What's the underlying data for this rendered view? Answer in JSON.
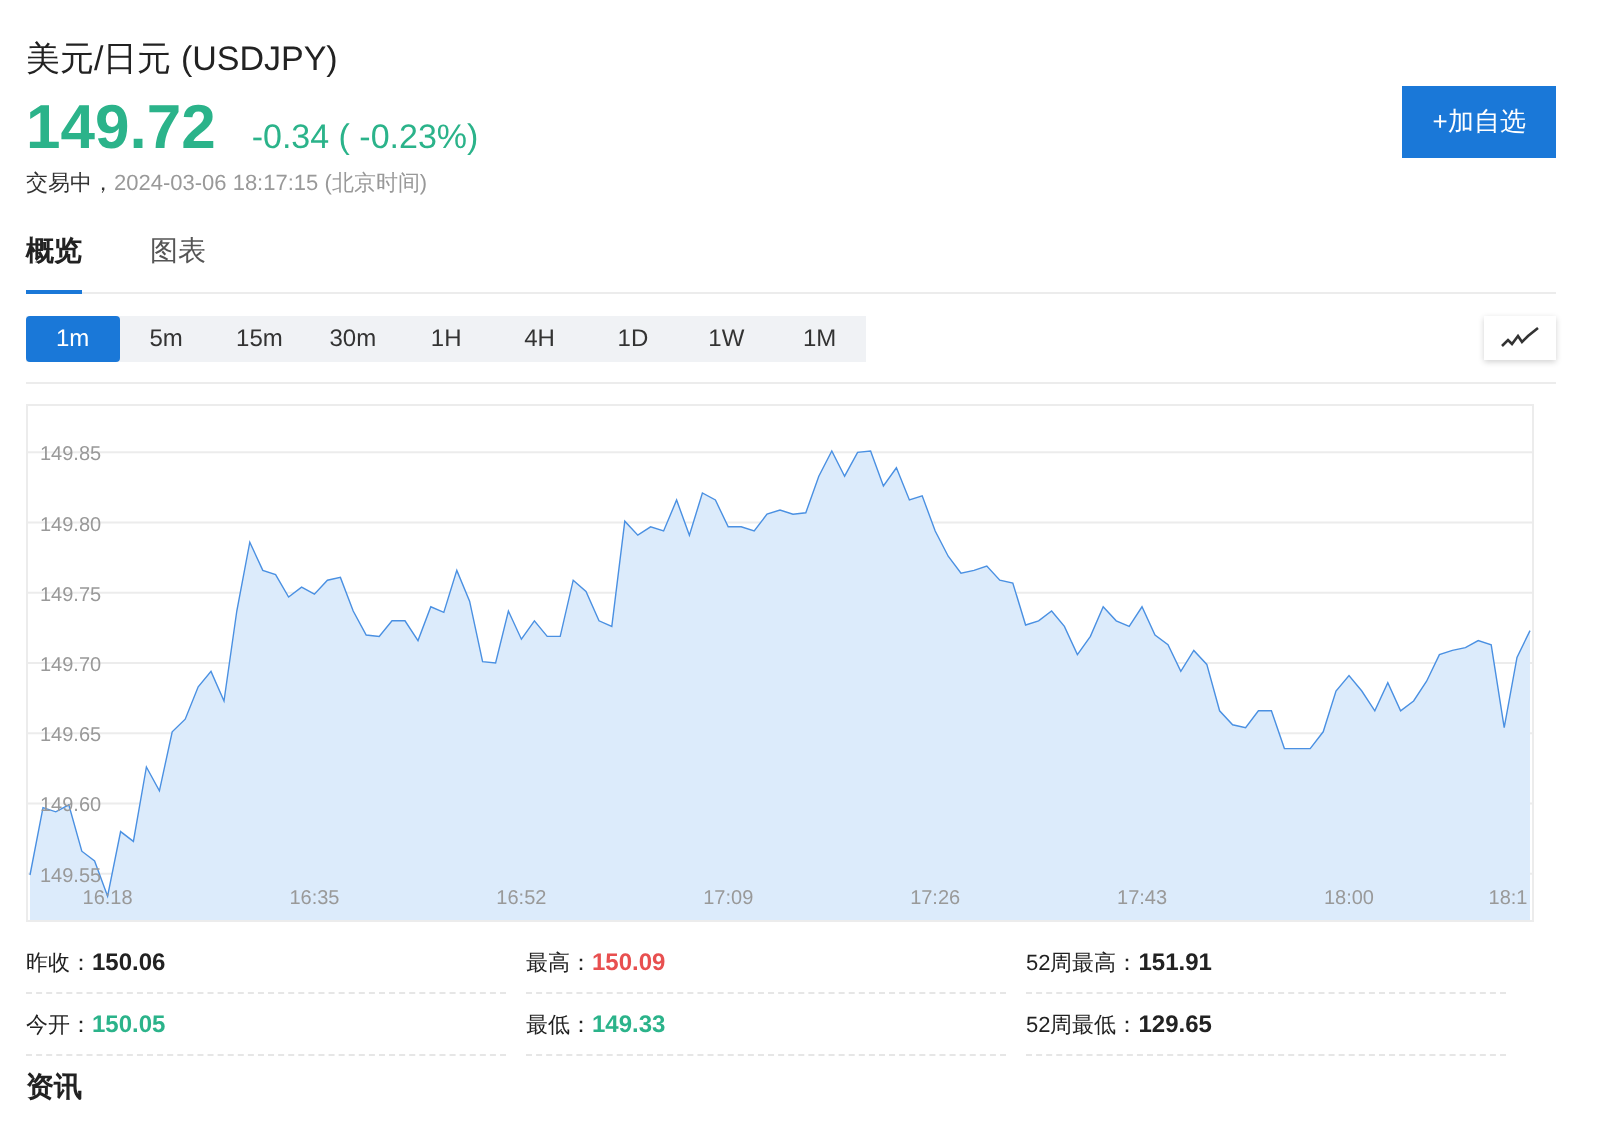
{
  "title": "美元/日元 (USDJPY)",
  "quote": {
    "price": "149.72",
    "change": "-0.34 ( -0.23%)",
    "status": "交易中，",
    "time": "2024-03-06 18:17:15 (北京时间)"
  },
  "watch_button": "+加自选",
  "tabs": [
    {
      "label": "概览",
      "selected": true
    },
    {
      "label": "图表",
      "selected": false
    }
  ],
  "periods": [
    {
      "label": "1m",
      "selected": true
    },
    {
      "label": "5m",
      "selected": false
    },
    {
      "label": "15m",
      "selected": false
    },
    {
      "label": "30m",
      "selected": false
    },
    {
      "label": "1H",
      "selected": false
    },
    {
      "label": "4H",
      "selected": false
    },
    {
      "label": "1D",
      "selected": false
    },
    {
      "label": "1W",
      "selected": false
    },
    {
      "label": "1M",
      "selected": false
    }
  ],
  "time_axis": [
    "16:18",
    "16:35",
    "16:52",
    "17:09",
    "17:26",
    "17:43",
    "18:00",
    "18:1"
  ],
  "chart_data": {
    "type": "area",
    "grid": true,
    "ylim": [
      149.517,
      149.883
    ],
    "yticks": [
      {
        "value": 149.55,
        "label": "149.55"
      },
      {
        "value": 149.6,
        "label": "149.60"
      },
      {
        "value": 149.65,
        "label": "149.65"
      },
      {
        "value": 149.7,
        "label": "149.70"
      },
      {
        "value": 149.75,
        "label": "149.75"
      },
      {
        "value": 149.8,
        "label": "149.80"
      },
      {
        "value": 149.85,
        "label": "149.85"
      }
    ],
    "series": [
      {
        "color": "#4a90e2",
        "values": [
          149.549,
          149.597,
          149.594,
          149.599,
          149.566,
          149.559,
          149.534,
          149.58,
          149.573,
          149.626,
          149.609,
          149.651,
          149.66,
          149.683,
          149.694,
          149.673,
          149.737,
          149.786,
          149.766,
          149.763,
          149.747,
          149.754,
          149.749,
          149.759,
          149.761,
          149.737,
          149.72,
          149.719,
          149.73,
          149.73,
          149.716,
          149.74,
          149.736,
          149.766,
          149.744,
          149.701,
          149.7,
          149.737,
          149.717,
          149.73,
          149.719,
          149.719,
          149.759,
          149.751,
          149.73,
          149.726,
          149.801,
          149.791,
          149.797,
          149.794,
          149.816,
          149.791,
          149.821,
          149.816,
          149.797,
          149.797,
          149.794,
          149.806,
          149.809,
          149.806,
          149.807,
          149.833,
          149.851,
          149.833,
          149.85,
          149.851,
          149.826,
          149.839,
          149.816,
          149.819,
          149.794,
          149.776,
          149.764,
          149.766,
          149.769,
          149.759,
          149.757,
          149.727,
          149.73,
          149.737,
          149.726,
          149.706,
          149.719,
          149.74,
          149.73,
          149.726,
          149.74,
          149.72,
          149.713,
          149.694,
          149.709,
          149.699,
          149.666,
          149.656,
          149.654,
          149.666,
          149.666,
          149.639,
          149.639,
          149.639,
          149.651,
          149.68,
          149.691,
          149.68,
          149.666,
          149.686,
          149.666,
          149.673,
          149.687,
          149.706,
          149.709,
          149.711,
          149.716,
          149.713,
          149.654,
          149.704,
          149.723
        ]
      }
    ]
  },
  "stats": [
    {
      "label": "昨收：",
      "value": "150.06",
      "color": "#222222"
    },
    {
      "label": "最高：",
      "value": "150.09",
      "color": "#e85050"
    },
    {
      "label": "52周最高：",
      "value": "151.91",
      "color": "#222222"
    },
    {
      "label": "今开：",
      "value": "150.05",
      "color": "#2bb38a"
    },
    {
      "label": "最低：",
      "value": "149.33",
      "color": "#2bb38a"
    },
    {
      "label": "52周最低：",
      "value": "129.65",
      "color": "#222222"
    }
  ],
  "section_title": "资讯"
}
